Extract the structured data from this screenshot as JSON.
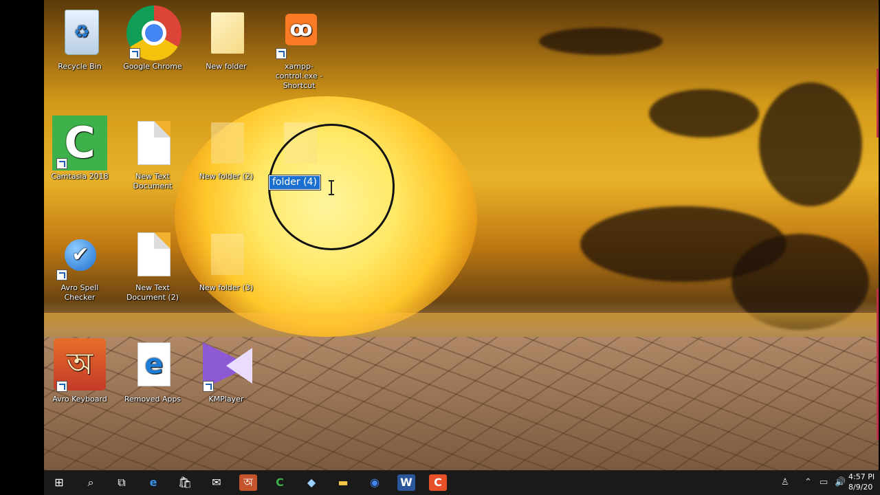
{
  "desktop": {
    "icons": {
      "recycle_bin": "Recycle Bin",
      "google_chrome": "Google Chrome",
      "new_folder": "New folder",
      "xampp": "xampp-control.exe - Shortcut",
      "camtasia": "Camtasia 2018",
      "new_text_document": "New Text Document",
      "new_folder_2": "New folder (2)",
      "avro_spell_checker": "Avro Spell Checker",
      "new_text_document_2": "New Text Document (2)",
      "new_folder_3": "New folder (3)",
      "avro_keyboard": "Avro Keyboard",
      "removed_apps": "Removed Apps",
      "kmplayer": "KMPlayer"
    },
    "rename_box": {
      "value": "folder (4)"
    }
  },
  "taskbar": {
    "clock_time": "4:57 PI",
    "clock_date": "8/9/20"
  },
  "colors": {
    "selection": "#1a6fcf",
    "taskbar": "#1a1a1a"
  }
}
